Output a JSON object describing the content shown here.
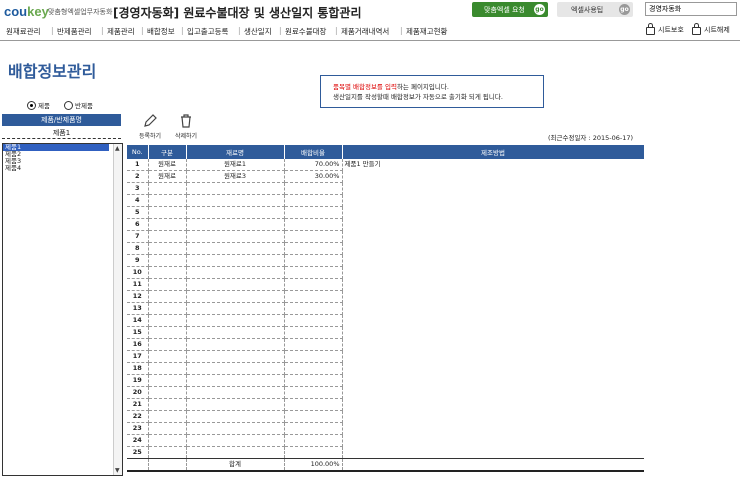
{
  "brand": {
    "logo_main": "cou",
    "logo_accent": "key",
    "tagline": "맞춤형엑셀업무자동화",
    "app_title": "[경영자동화] 원료수불대장 및 생산일지 통합관리"
  },
  "header_buttons": {
    "custom": "맞춤엑셀 요청",
    "excel": "엑셀사용팁",
    "go": "go",
    "search_value": "경영자동화"
  },
  "menu": [
    "원재료관리",
    "반제품관리",
    "제품관리",
    "배합정보",
    "입고출고등록",
    "생산일지",
    "원료수불대장",
    "제품거래내역서",
    "제품재고현황"
  ],
  "lock": {
    "protect": "시트보호",
    "unprotect": "시트해제"
  },
  "page_title": "배합정보관리",
  "notice": {
    "line1_red": "품목별 배합정보를 입력",
    "line1_rest": "하는 페이지입니다.",
    "line2": "생산일지를 작성할때 배합정보가 자동으로 출기화 되게 됩니다."
  },
  "radios": [
    {
      "label": "제품",
      "checked": true
    },
    {
      "label": "반제품",
      "checked": false
    }
  ],
  "left_panel": {
    "header": "제품/반제품명",
    "selected": "제품1",
    "items": [
      "제품1",
      "제품2",
      "제품3",
      "제품4"
    ]
  },
  "tools": {
    "register": "등록하기",
    "delete": "삭제하기"
  },
  "updated": "(최근수정일자 : 2015-06-17)",
  "table": {
    "columns": [
      "No.",
      "구분",
      "재료명",
      "배합비율",
      "제조방법"
    ],
    "rows": [
      [
        "1",
        "원재료",
        "원재료1",
        "70.00%",
        "제품1 만들기"
      ],
      [
        "2",
        "원재료",
        "원재료3",
        "30.00%",
        ""
      ]
    ],
    "row_count": 25,
    "total_label": "합계",
    "total_value": "100.00%"
  },
  "colors": {
    "accent": "#2f5b9a",
    "green": "#3a8a2e"
  }
}
